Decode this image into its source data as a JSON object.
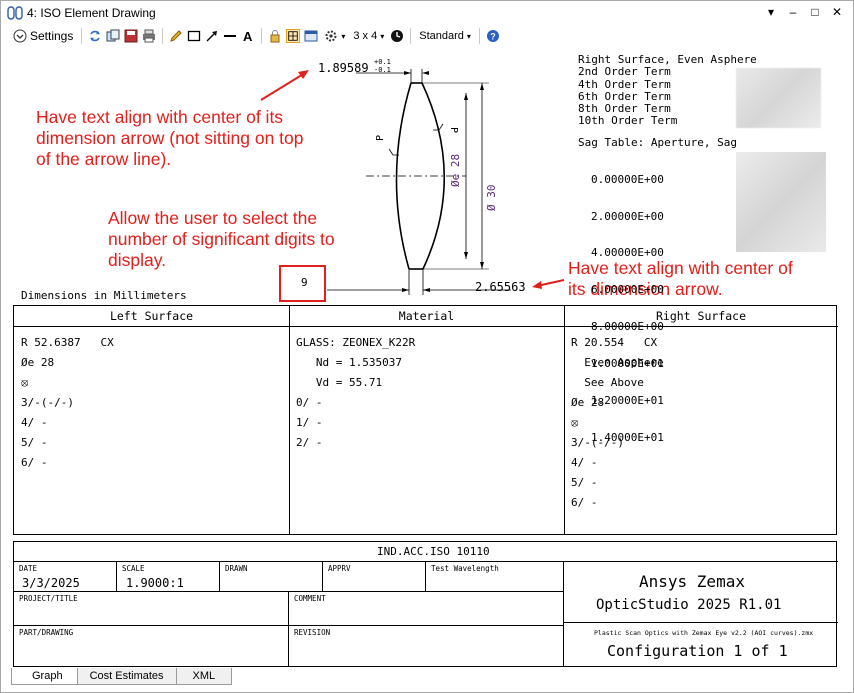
{
  "window": {
    "title": "4: ISO Element Drawing",
    "controls": [
      "▾",
      "–",
      "□",
      "✕"
    ]
  },
  "toolbar": {
    "settings_label": "Settings",
    "grid_label": "3 x 4",
    "style_label": "Standard",
    "icons": [
      "refresh-icon",
      "copy-icon",
      "save-icon",
      "print-icon",
      "pencil-icon",
      "rectangle-icon",
      "arrow-icon",
      "line-icon",
      "text-icon",
      "lock-icon",
      "layout-icon",
      "window-icon",
      "gear-icon",
      "clock-icon",
      "help-icon"
    ]
  },
  "drawing": {
    "top_dim_value": "1.89589",
    "top_dim_tol_plus": "+0.1",
    "top_dim_tol_minus": "-0.1",
    "bottom_dim_value": "2.65563",
    "clear_aperture": "Øe 28",
    "diameter": "Ø 30",
    "surface_marker": "P",
    "dimensions_label": "Dimensions in Millimeters",
    "sig_digits_value": "9"
  },
  "notes": {
    "note1": "Have text align with center of its dimension arrow (not sitting on top of the arrow line).",
    "note2": "Allow the user to select the number of significant digits to display.",
    "note3": "Have text align with center of its dimension arrow."
  },
  "asphere": {
    "lines": [
      "Right Surface, Even Asphere",
      "2nd Order Term",
      "4th Order Term",
      "6th Order Term",
      "8th Order Term",
      "10th Order Term"
    ]
  },
  "sag_table": {
    "title": "Sag Table: Aperture, Sag",
    "apertures": [
      "0.00000E+00",
      "2.00000E+00",
      "4.00000E+00",
      "6.00000E+00",
      "8.00000E+00",
      "1.00000E+01",
      "1.20000E+01",
      "1.40000E+01"
    ]
  },
  "surface_table": {
    "headers": [
      "Left Surface",
      "Material",
      "Right Surface"
    ],
    "left": [
      "R 52.6387   CX",
      "Øe 28",
      "⦻",
      "3/-(-/-)",
      "4/ -",
      "5/ -",
      "6/ -"
    ],
    "material": [
      "GLASS: ZEONEX_K22R",
      "   Nd = 1.535037",
      "   Vd = 55.71",
      "0/ -",
      "1/ -",
      "2/ -"
    ],
    "right": [
      "R 20.554   CX",
      "  Even Asphere",
      "  See Above",
      "Øe 28",
      "⦻",
      "3/-(-/-)",
      "4/ -",
      "5/ -",
      "6/ -"
    ]
  },
  "title_block": {
    "standard": "IND.ACC.ISO 10110",
    "date_label": "DATE",
    "date_value": "3/3/2025",
    "scale_label": "SCALE",
    "scale_value": "1.9000:1",
    "drawn_label": "DRAWN",
    "apprv_label": "APPRV",
    "wavelength_label": "Test Wavelength",
    "project_label": "PROJECT/TITLE",
    "comment_label": "COMMENT",
    "part_label": "PART/DRAWING",
    "revision_label": "REVISION",
    "company": "Ansys Zemax",
    "product": "OpticStudio 2025 R1.01",
    "file": "Plastic Scan Optics with Zemax Eye v2.2 (AOI curves).zmx",
    "config": "Configuration 1 of 1"
  },
  "tabs": [
    "Graph",
    "Cost Estimates",
    "XML"
  ],
  "colors": {
    "annotation": "#e0201c",
    "dim_purple": "#5a2a7a",
    "active_tool": "#fde7b3"
  }
}
